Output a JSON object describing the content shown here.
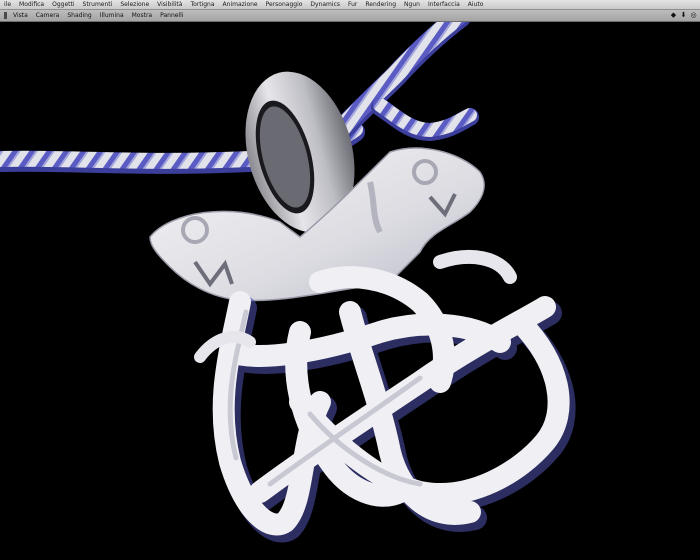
{
  "app": {
    "menu": [
      "ile",
      "Modifica",
      "Oggetti",
      "Strumenti",
      "Selezione",
      "Visibilità",
      "Tortigna",
      "Animazione",
      "Personaggio",
      "Dynamics",
      "Fur",
      "Rendering",
      "Ngun",
      "Interfaccia",
      "Aiuto"
    ]
  },
  "panel": {
    "menu": [
      "Vista",
      "Camera",
      "Shading",
      "Illumina",
      "Mostra",
      "Pannelli"
    ]
  },
  "viewport": {
    "background": "#000000",
    "model_color": "#e8e8ec",
    "shadow_tint": "#4b4ec8"
  },
  "icons": {
    "panel_controls": [
      "layout-single-icon",
      "layout-four-icon",
      "panel-close-icon"
    ]
  }
}
